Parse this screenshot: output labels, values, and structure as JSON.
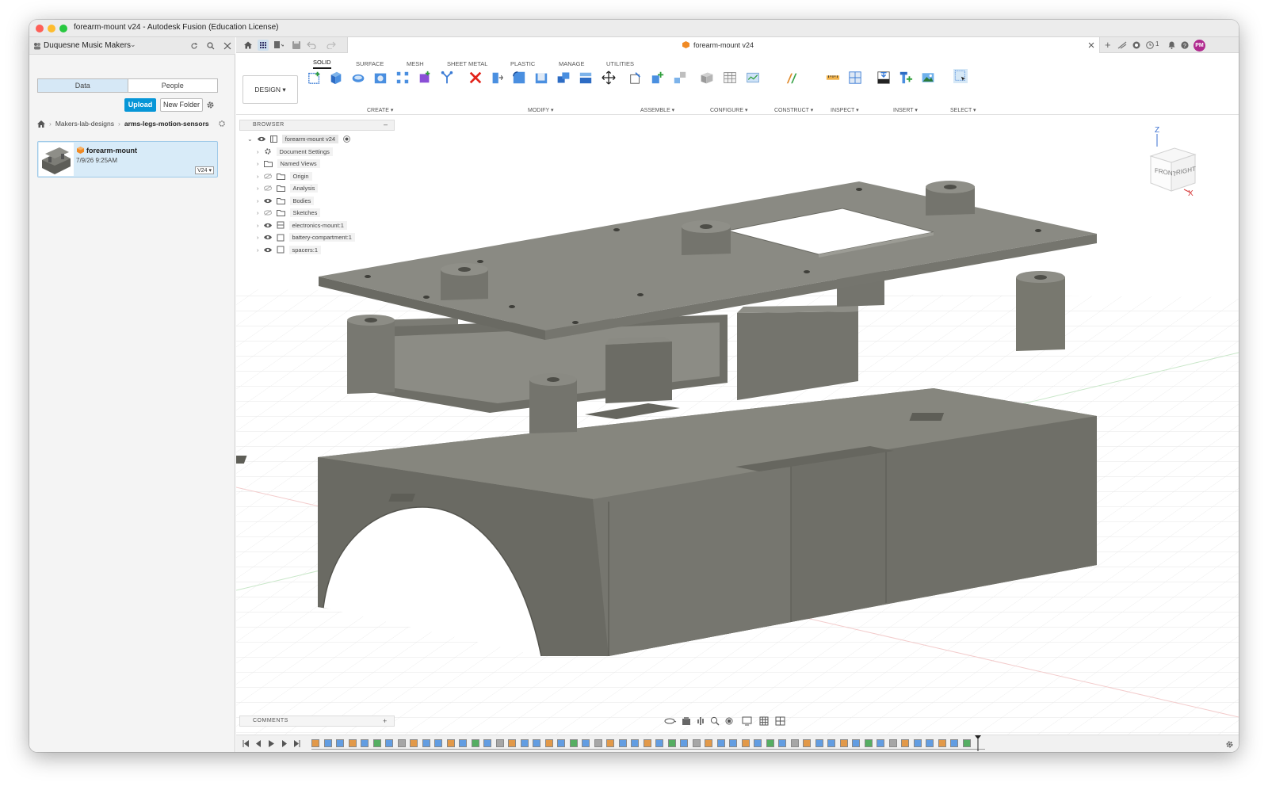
{
  "window": {
    "title": "forearm-mount v24 - Autodesk Fusion (Education License)"
  },
  "data_panel": {
    "team_name": "Duquesne Music Makers",
    "tabs": [
      "Data",
      "People"
    ],
    "upload_label": "Upload",
    "new_folder_label": "New Folder",
    "breadcrumb": [
      "Makers-lab-designs",
      "arms-legs-motion-sensors"
    ],
    "file": {
      "name": "forearm-mount",
      "date": "7/9/26 9:25AM",
      "version": "V24 ▾"
    }
  },
  "document": {
    "tab_title": "forearm-mount v24",
    "user_initials": "PM",
    "notification_count": "1"
  },
  "toolbar": {
    "workspace": "DESIGN ▾",
    "tabs": [
      "SOLID",
      "SURFACE",
      "MESH",
      "SHEET METAL",
      "PLASTIC",
      "MANAGE",
      "UTILITIES"
    ],
    "groups": [
      "CREATE ▾",
      "MODIFY ▾",
      "ASSEMBLE ▾",
      "CONFIGURE ▾",
      "CONSTRUCT ▾",
      "INSPECT ▾",
      "INSERT ▾",
      "SELECT ▾"
    ]
  },
  "browser": {
    "header": "BROWSER",
    "root": "forearm-mount v24",
    "nodes": [
      "Document Settings",
      "Named Views",
      "Origin",
      "Analysis",
      "Bodies",
      "Sketches",
      "electronics-mount:1",
      "battery-compartment:1",
      "spacers:1"
    ]
  },
  "viewcube": {
    "front": "FRONT",
    "right": "RIGHT",
    "z": "Z",
    "x": "X"
  },
  "comments": {
    "label": "COMMENTS",
    "add": "+"
  },
  "colors": {
    "accent": "#0696d7",
    "model_dark": "#6c6c66",
    "model_mid": "#7b7b75",
    "model_light": "#8c8c86",
    "avatar": "#b02a8f"
  }
}
